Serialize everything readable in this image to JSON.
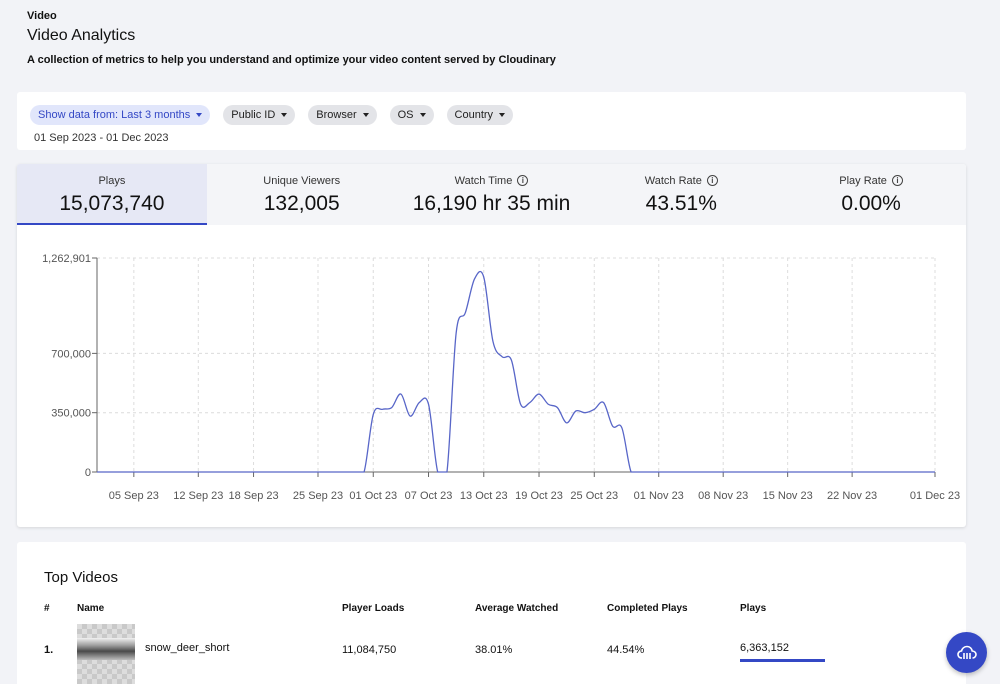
{
  "header": {
    "section": "Video",
    "title": "Video Analytics",
    "subtitle": "A collection of metrics to help you understand and optimize your video content served by Cloudinary"
  },
  "filters": {
    "date_filter": "Show data from: Last 3 months",
    "public_id": "Public ID",
    "browser": "Browser",
    "os": "OS",
    "country": "Country",
    "date_range": "01 Sep 2023 - 01 Dec 2023"
  },
  "metrics": [
    {
      "label": "Plays",
      "value": "15,073,740",
      "info": false
    },
    {
      "label": "Unique Viewers",
      "value": "132,005",
      "info": false
    },
    {
      "label": "Watch Time",
      "value": "16,190 hr 35 min",
      "info": true
    },
    {
      "label": "Watch Rate",
      "value": "43.51%",
      "info": true
    },
    {
      "label": "Play Rate",
      "value": "0.00%",
      "info": true
    }
  ],
  "chart_data": {
    "type": "line",
    "ytick_labels": [
      "0",
      "350,000",
      "700,000",
      "1,262,901"
    ],
    "yticks": [
      0,
      350000,
      700000,
      1262901
    ],
    "ylim": [
      0,
      1262901
    ],
    "xtick_labels": [
      "05 Sep 23",
      "12 Sep 23",
      "18 Sep 23",
      "25 Sep 23",
      "01 Oct 23",
      "07 Oct 23",
      "13 Oct 23",
      "19 Oct 23",
      "25 Oct 23",
      "01 Nov 23",
      "08 Nov 23",
      "15 Nov 23",
      "22 Nov 23",
      "01 Dec 23"
    ],
    "xtick_dates": [
      "2023-09-05",
      "2023-09-12",
      "2023-09-18",
      "2023-09-25",
      "2023-10-01",
      "2023-10-07",
      "2023-10-13",
      "2023-10-19",
      "2023-10-25",
      "2023-11-01",
      "2023-11-08",
      "2023-11-15",
      "2023-11-22",
      "2023-12-01"
    ],
    "xlim": [
      "2023-09-01",
      "2023-12-01"
    ],
    "grid": true,
    "color": "#5866c8",
    "x": [
      "2023-09-01",
      "2023-09-05",
      "2023-09-12",
      "2023-09-18",
      "2023-09-25",
      "2023-09-29",
      "2023-09-30",
      "2023-10-01",
      "2023-10-02",
      "2023-10-03",
      "2023-10-04",
      "2023-10-05",
      "2023-10-06",
      "2023-10-07",
      "2023-10-08",
      "2023-10-09",
      "2023-10-10",
      "2023-10-11",
      "2023-10-12",
      "2023-10-13",
      "2023-10-14",
      "2023-10-15",
      "2023-10-16",
      "2023-10-17",
      "2023-10-18",
      "2023-10-19",
      "2023-10-20",
      "2023-10-21",
      "2023-10-22",
      "2023-10-23",
      "2023-10-24",
      "2023-10-25",
      "2023-10-26",
      "2023-10-27",
      "2023-10-28",
      "2023-10-29",
      "2023-10-30",
      "2023-10-31",
      "2023-11-01",
      "2023-11-02",
      "2023-11-08",
      "2023-11-15",
      "2023-11-22",
      "2023-12-01"
    ],
    "values": [
      0,
      0,
      0,
      0,
      0,
      0,
      0,
      340000,
      370000,
      380000,
      460000,
      330000,
      410000,
      400000,
      0,
      0,
      820000,
      940000,
      1140000,
      1150000,
      770000,
      680000,
      660000,
      400000,
      410000,
      460000,
      400000,
      380000,
      290000,
      360000,
      350000,
      370000,
      410000,
      270000,
      260000,
      0,
      0,
      0,
      0,
      0,
      0,
      0,
      0,
      0
    ]
  },
  "top_videos": {
    "title": "Top Videos",
    "columns": [
      "#",
      "Name",
      "Player Loads",
      "Average Watched",
      "Completed Plays",
      "Plays"
    ],
    "rows": [
      {
        "rank": "1.",
        "name": "snow_deer_short",
        "player_loads": "11,084,750",
        "average_watched": "38.01%",
        "completed_plays": "44.54%",
        "plays": "6,363,152"
      }
    ]
  }
}
